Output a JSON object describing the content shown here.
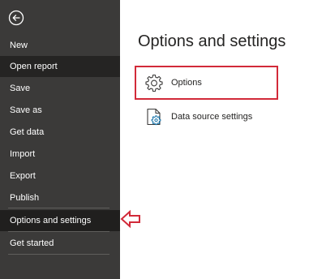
{
  "sidebar": {
    "back_icon": "arrow-left-icon",
    "items": [
      {
        "label": "New"
      },
      {
        "label": "Open report"
      },
      {
        "label": "Save"
      },
      {
        "label": "Save as"
      },
      {
        "label": "Get data"
      },
      {
        "label": "Import"
      },
      {
        "label": "Export"
      },
      {
        "label": "Publish"
      },
      {
        "label": "Options and settings"
      },
      {
        "label": "Get started"
      }
    ]
  },
  "main": {
    "title": "Options and settings",
    "options": [
      {
        "label": "Options",
        "icon": "gear-icon"
      },
      {
        "label": "Data source settings",
        "icon": "data-source-settings-icon"
      }
    ]
  },
  "colors": {
    "sidebar_bg": "#3b3a39",
    "selected_bg": "#201f1e",
    "highlight_red": "#d22a39",
    "accent_blue": "#1170a8"
  }
}
